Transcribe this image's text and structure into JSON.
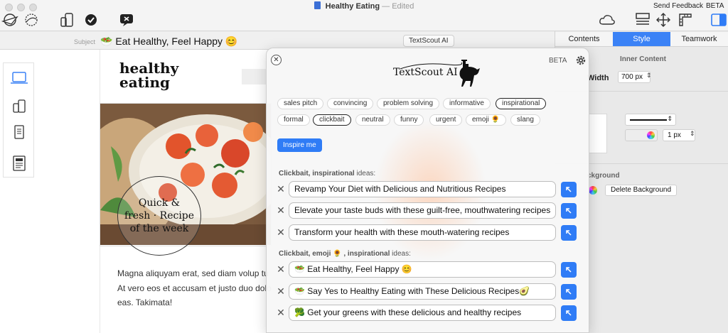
{
  "window": {
    "title": "Healthy Eating",
    "separator": "—",
    "status": "Edited",
    "send_feedback": "Send Feedback",
    "beta": "BETA"
  },
  "toolbar": {
    "icons": [
      "plane-send-icon",
      "stamp-icon",
      "devices-icon",
      "checkmark-icon",
      "chat-cancel-icon",
      "cloud-icon",
      "layout-icon",
      "move-icon",
      "ruler-icon",
      "sidebar-toggle-icon"
    ]
  },
  "subject": {
    "label": "Subject",
    "value": "🥗 Eat Healthy, Feel Happy 😊",
    "textscout_button": "TextScout AI"
  },
  "email": {
    "logo_line1": "healthy",
    "logo_line2": "eating",
    "circle_line1": "Quick &",
    "circle_line2": "fresh · Recipe",
    "circle_line3": "of the week",
    "body_line1": "Magna aliquyam erat, sed diam volup tu",
    "body_line2": "At vero eos et accusam et justo duo dolo",
    "body_line3": "eas. Takimata!"
  },
  "right_panel": {
    "tabs": [
      "Contents",
      "Style",
      "Teamwork"
    ],
    "active_tab": "Style",
    "inner_content_title": "Inner Content",
    "width_label": "Width",
    "width_value": "700 px",
    "border_px": "1 px",
    "background_label": "ckground",
    "delete_background": "Delete Background"
  },
  "textscout": {
    "brand": "TextScout AI",
    "beta": "BETA",
    "chips_row1": [
      "sales pitch",
      "convincing",
      "problem solving",
      "informative",
      "inspirational"
    ],
    "chips_row2": [
      "formal",
      "clickbait",
      "neutral",
      "funny",
      "urgent",
      "emoji 🌻",
      "slang"
    ],
    "selected_chips": [
      "inspirational",
      "clickbait"
    ],
    "inspire_button": "Inspire me",
    "group1_label_bold": "Clickbait, inspirational",
    "group1_label_rest": "ideas:",
    "group1_ideas": [
      "Revamp Your Diet with Delicious and Nutritious Recipes",
      "Elevate your taste buds with these guilt-free, mouthwatering recipes",
      "Transform your health with these mouth-watering recipes"
    ],
    "group2_label_bold": "Clickbait, emoji 🌻 , inspirational",
    "group2_label_rest": "ideas:",
    "group2_ideas": [
      "🥗 Eat Healthy, Feel Happy 😊",
      "🥗 Say Yes to Healthy Eating with These Delicious Recipes🥑",
      "🥦 Get your greens with these delicious and healthy recipes"
    ]
  }
}
